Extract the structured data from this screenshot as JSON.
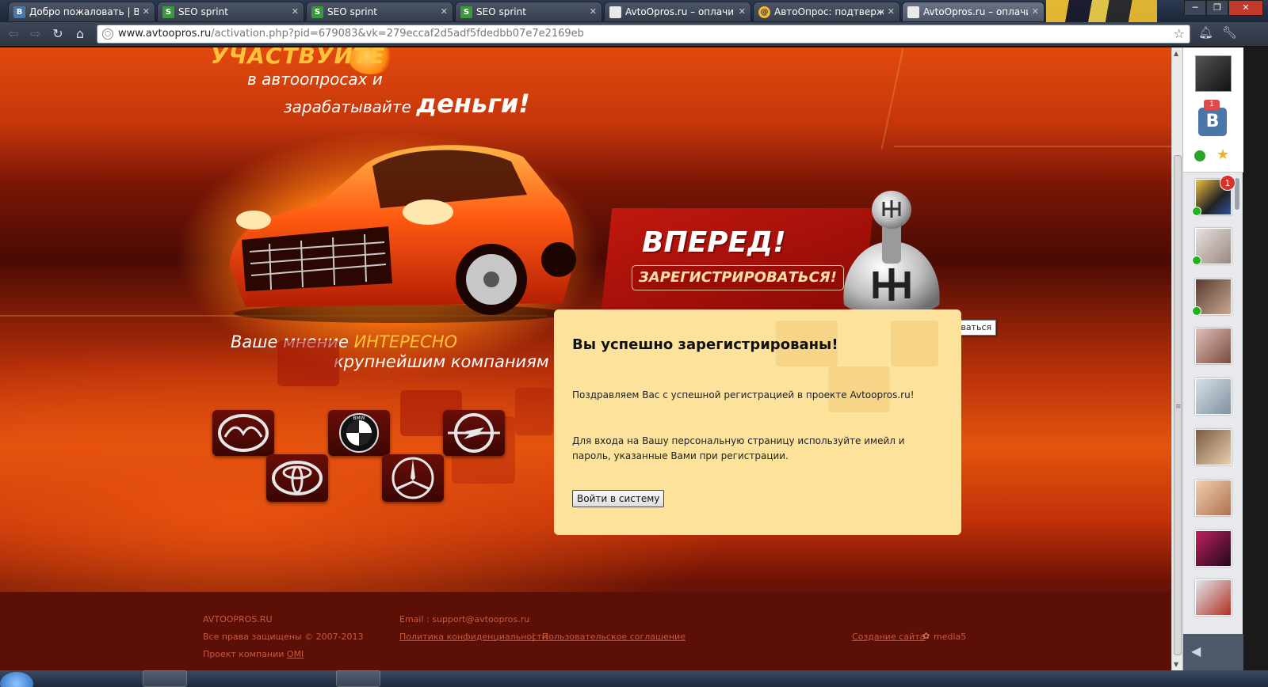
{
  "browser": {
    "tabs": [
      {
        "icon": "vk-icon",
        "glyph": "B",
        "title": "Добро пожаловать | ВКон"
      },
      {
        "icon": "seosprint-icon",
        "glyph": "S",
        "title": "SEO sprint"
      },
      {
        "icon": "seosprint-icon",
        "glyph": "S",
        "title": "SEO sprint"
      },
      {
        "icon": "seosprint-icon",
        "glyph": "S",
        "title": "SEO sprint"
      },
      {
        "icon": "document-icon",
        "glyph": "",
        "title": "AvtoOpros.ru – оплачивае"
      },
      {
        "icon": "mail-icon",
        "glyph": "@",
        "title": "АвтоОпрос: подтвержден"
      },
      {
        "icon": "document-icon",
        "glyph": "",
        "title": "AvtoOpros.ru – оплачивае"
      }
    ],
    "url_host": "www.avtoopros.ru",
    "url_path": "/activation.php?pid=679083&vk=279eccaf2d5adf5fdedbb07e7e2169eb"
  },
  "page": {
    "promo_line1": "УЧАСТВУЙТЕ",
    "promo_line2": "в автоопросах и",
    "promo_line3": "зарабатывайте",
    "promo_money": "деньги!",
    "cta_title": "ВПЕРЕД!",
    "cta_button": "ЗАРЕГИСТРИРОВАТЬСЯ!",
    "tooltip": "Вперед! зарегистрироваться",
    "slogan_prefix": "Ваше мнение ",
    "slogan_highlight": "ИНТЕРЕСНО",
    "slogan_line2": "крупнейшим компаниям",
    "brands": [
      "Mazda",
      "BMW",
      "Opel",
      "Toyota",
      "Mercedes-Benz"
    ],
    "success": {
      "title": "Вы успешно зарегистрированы!",
      "congrats": "Поздравляем Вас с успешной регистрацией в проекте Avtoopros.ru!",
      "instructions": "Для входа на Вашу персональную страницу используйте имейл и пароль, указанные Вами при регистрации.",
      "login_button": "Войти в систему"
    },
    "footer": {
      "site_name": "AVTOOPROS.RU",
      "copyright": "Все права защищены © 2007-2013",
      "project_prefix": "Проект компании ",
      "project_company": "OMI",
      "email": "Email : support@avtoopros.ru",
      "privacy": "Политика конфиденциальности",
      "separator": "|",
      "agreement": "Пользовательское соглашение",
      "site_creation": "Создание сайта",
      "agency": "media5"
    }
  },
  "sidebar": {
    "vk_badge": "1",
    "vk_letter": "В",
    "friend_badge": "1"
  },
  "colors": {
    "accent_orange": "#ff7a10",
    "panel_bg": "#fde29c",
    "highlight_yellow": "#ffc23a",
    "footer_text": "#c9593b"
  }
}
